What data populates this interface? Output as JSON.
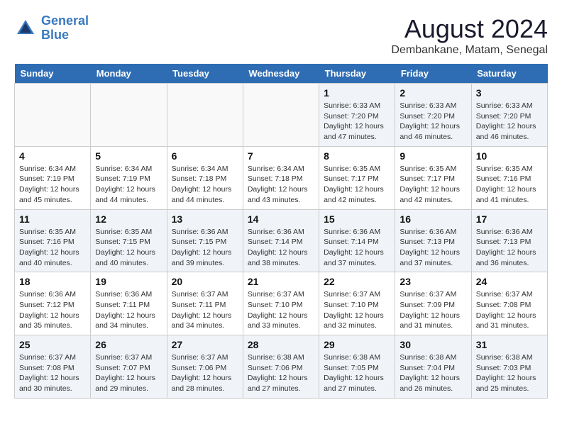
{
  "logo": {
    "line1": "General",
    "line2": "Blue"
  },
  "title": "August 2024",
  "subtitle": "Dembankane, Matam, Senegal",
  "days_of_week": [
    "Sunday",
    "Monday",
    "Tuesday",
    "Wednesday",
    "Thursday",
    "Friday",
    "Saturday"
  ],
  "weeks": [
    [
      {
        "day": "",
        "info": ""
      },
      {
        "day": "",
        "info": ""
      },
      {
        "day": "",
        "info": ""
      },
      {
        "day": "",
        "info": ""
      },
      {
        "day": "1",
        "info": "Sunrise: 6:33 AM\nSunset: 7:20 PM\nDaylight: 12 hours\nand 47 minutes."
      },
      {
        "day": "2",
        "info": "Sunrise: 6:33 AM\nSunset: 7:20 PM\nDaylight: 12 hours\nand 46 minutes."
      },
      {
        "day": "3",
        "info": "Sunrise: 6:33 AM\nSunset: 7:20 PM\nDaylight: 12 hours\nand 46 minutes."
      }
    ],
    [
      {
        "day": "4",
        "info": "Sunrise: 6:34 AM\nSunset: 7:19 PM\nDaylight: 12 hours\nand 45 minutes."
      },
      {
        "day": "5",
        "info": "Sunrise: 6:34 AM\nSunset: 7:19 PM\nDaylight: 12 hours\nand 44 minutes."
      },
      {
        "day": "6",
        "info": "Sunrise: 6:34 AM\nSunset: 7:18 PM\nDaylight: 12 hours\nand 44 minutes."
      },
      {
        "day": "7",
        "info": "Sunrise: 6:34 AM\nSunset: 7:18 PM\nDaylight: 12 hours\nand 43 minutes."
      },
      {
        "day": "8",
        "info": "Sunrise: 6:35 AM\nSunset: 7:17 PM\nDaylight: 12 hours\nand 42 minutes."
      },
      {
        "day": "9",
        "info": "Sunrise: 6:35 AM\nSunset: 7:17 PM\nDaylight: 12 hours\nand 42 minutes."
      },
      {
        "day": "10",
        "info": "Sunrise: 6:35 AM\nSunset: 7:16 PM\nDaylight: 12 hours\nand 41 minutes."
      }
    ],
    [
      {
        "day": "11",
        "info": "Sunrise: 6:35 AM\nSunset: 7:16 PM\nDaylight: 12 hours\nand 40 minutes."
      },
      {
        "day": "12",
        "info": "Sunrise: 6:35 AM\nSunset: 7:15 PM\nDaylight: 12 hours\nand 40 minutes."
      },
      {
        "day": "13",
        "info": "Sunrise: 6:36 AM\nSunset: 7:15 PM\nDaylight: 12 hours\nand 39 minutes."
      },
      {
        "day": "14",
        "info": "Sunrise: 6:36 AM\nSunset: 7:14 PM\nDaylight: 12 hours\nand 38 minutes."
      },
      {
        "day": "15",
        "info": "Sunrise: 6:36 AM\nSunset: 7:14 PM\nDaylight: 12 hours\nand 37 minutes."
      },
      {
        "day": "16",
        "info": "Sunrise: 6:36 AM\nSunset: 7:13 PM\nDaylight: 12 hours\nand 37 minutes."
      },
      {
        "day": "17",
        "info": "Sunrise: 6:36 AM\nSunset: 7:13 PM\nDaylight: 12 hours\nand 36 minutes."
      }
    ],
    [
      {
        "day": "18",
        "info": "Sunrise: 6:36 AM\nSunset: 7:12 PM\nDaylight: 12 hours\nand 35 minutes."
      },
      {
        "day": "19",
        "info": "Sunrise: 6:36 AM\nSunset: 7:11 PM\nDaylight: 12 hours\nand 34 minutes."
      },
      {
        "day": "20",
        "info": "Sunrise: 6:37 AM\nSunset: 7:11 PM\nDaylight: 12 hours\nand 34 minutes."
      },
      {
        "day": "21",
        "info": "Sunrise: 6:37 AM\nSunset: 7:10 PM\nDaylight: 12 hours\nand 33 minutes."
      },
      {
        "day": "22",
        "info": "Sunrise: 6:37 AM\nSunset: 7:10 PM\nDaylight: 12 hours\nand 32 minutes."
      },
      {
        "day": "23",
        "info": "Sunrise: 6:37 AM\nSunset: 7:09 PM\nDaylight: 12 hours\nand 31 minutes."
      },
      {
        "day": "24",
        "info": "Sunrise: 6:37 AM\nSunset: 7:08 PM\nDaylight: 12 hours\nand 31 minutes."
      }
    ],
    [
      {
        "day": "25",
        "info": "Sunrise: 6:37 AM\nSunset: 7:08 PM\nDaylight: 12 hours\nand 30 minutes."
      },
      {
        "day": "26",
        "info": "Sunrise: 6:37 AM\nSunset: 7:07 PM\nDaylight: 12 hours\nand 29 minutes."
      },
      {
        "day": "27",
        "info": "Sunrise: 6:37 AM\nSunset: 7:06 PM\nDaylight: 12 hours\nand 28 minutes."
      },
      {
        "day": "28",
        "info": "Sunrise: 6:38 AM\nSunset: 7:06 PM\nDaylight: 12 hours\nand 27 minutes."
      },
      {
        "day": "29",
        "info": "Sunrise: 6:38 AM\nSunset: 7:05 PM\nDaylight: 12 hours\nand 27 minutes."
      },
      {
        "day": "30",
        "info": "Sunrise: 6:38 AM\nSunset: 7:04 PM\nDaylight: 12 hours\nand 26 minutes."
      },
      {
        "day": "31",
        "info": "Sunrise: 6:38 AM\nSunset: 7:03 PM\nDaylight: 12 hours\nand 25 minutes."
      }
    ]
  ]
}
